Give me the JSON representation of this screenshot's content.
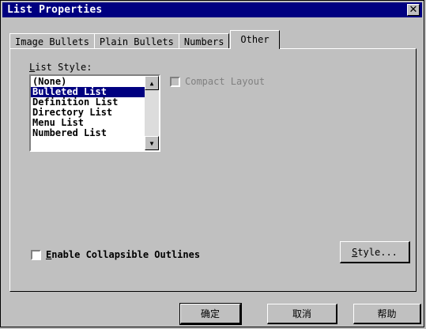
{
  "window": {
    "title": "List Properties",
    "close_glyph": "✕"
  },
  "tabs": [
    {
      "label": "Image Bullets",
      "active": false
    },
    {
      "label": "Plain Bullets",
      "active": false
    },
    {
      "label": "Numbers",
      "active": false
    },
    {
      "label": "Other",
      "active": true
    }
  ],
  "list_style": {
    "label_first": "L",
    "label_rest": "ist Style:",
    "items": [
      {
        "label": "(None)",
        "selected": false
      },
      {
        "label": "Bulleted List",
        "selected": true
      },
      {
        "label": "Definition List",
        "selected": false
      },
      {
        "label": "Directory List",
        "selected": false
      },
      {
        "label": "Menu List",
        "selected": false
      },
      {
        "label": "Numbered List",
        "selected": false
      }
    ]
  },
  "compact_layout": {
    "label": "Compact Layout",
    "checked": false,
    "disabled": true
  },
  "collapsible": {
    "label_first": "E",
    "label_rest": "nable Collapsible Outlines",
    "checked": false
  },
  "buttons": {
    "style_first": "S",
    "style_rest": "tyle...",
    "ok": "确定",
    "cancel": "取消",
    "help": "帮助"
  }
}
